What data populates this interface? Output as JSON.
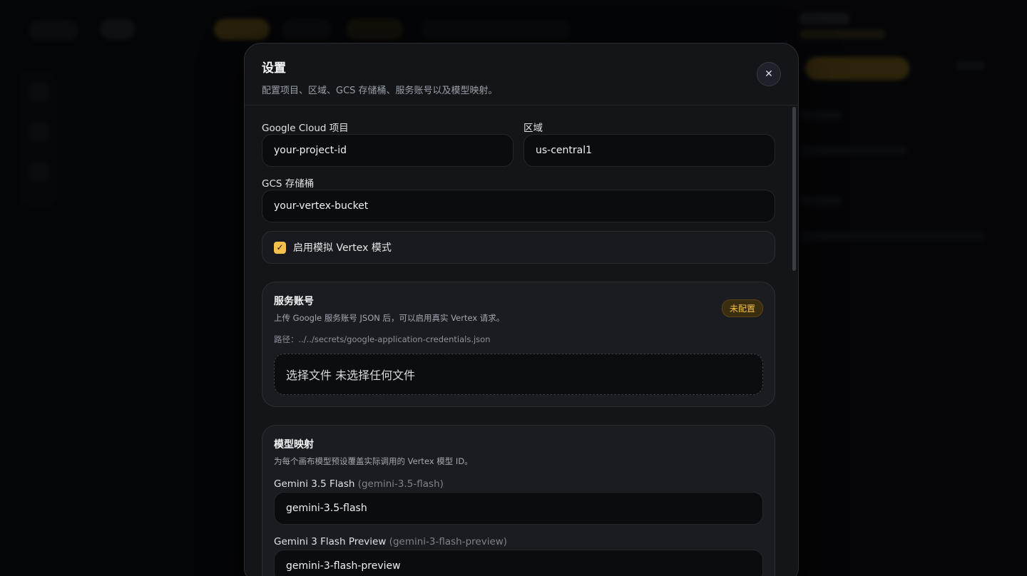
{
  "modal": {
    "title": "设置",
    "subtitle": "配置项目、区域、GCS 存储桶、服务账号以及模型映射。",
    "close_glyph": "✕"
  },
  "form": {
    "project": {
      "label": "Google Cloud 项目",
      "value": "your-project-id"
    },
    "region": {
      "label": "区域",
      "value": "us-central1"
    },
    "bucket": {
      "label": "GCS 存储桶",
      "value": "your-vertex-bucket"
    },
    "mock_mode": {
      "label": "启用模拟 Vertex 模式",
      "checked": true,
      "check_glyph": "✓"
    }
  },
  "service_account": {
    "title": "服务账号",
    "description": "上传 Google 服务账号 JSON 后，可以启用真实 Vertex 请求。",
    "path": "路径：../../secrets/google-application-credentials.json",
    "status_badge": "未配置",
    "file_input_text": "选择文件 未选择任何文件"
  },
  "model_mapping": {
    "title": "模型映射",
    "description": "为每个画布模型预设覆盖实际调用的 Vertex 模型 ID。",
    "items": [
      {
        "name": "Gemini 3.5 Flash",
        "id": "(gemini-3.5-flash)",
        "value": "gemini-3.5-flash"
      },
      {
        "name": "Gemini 3 Flash Preview",
        "id": "(gemini-3-flash-preview)",
        "value": "gemini-3-flash-preview"
      }
    ]
  },
  "colors": {
    "accent": "#f3c14b",
    "background": "#07080b",
    "modal": "#131519"
  }
}
